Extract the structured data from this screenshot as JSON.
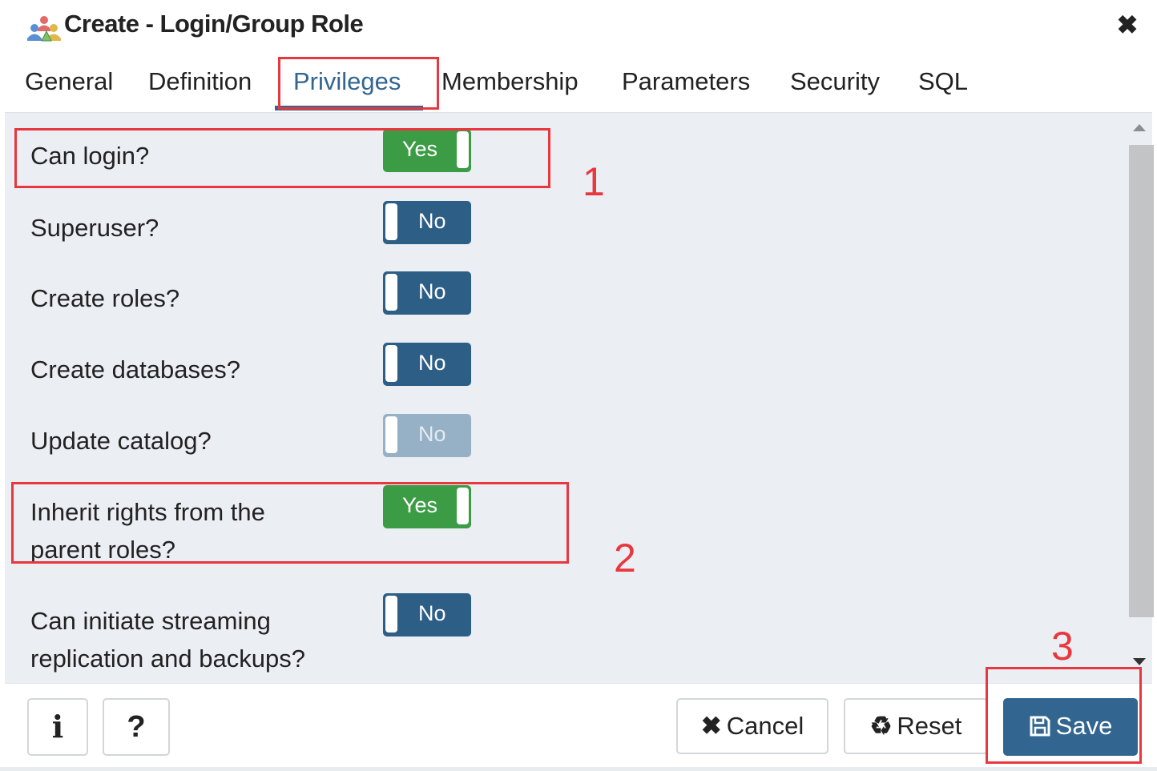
{
  "dialog": {
    "title": "Create - Login/Group Role",
    "close_glyph": "✖"
  },
  "tabs": [
    {
      "label": "General",
      "active": false
    },
    {
      "label": "Definition",
      "active": false
    },
    {
      "label": "Privileges",
      "active": true
    },
    {
      "label": "Membership",
      "active": false
    },
    {
      "label": "Parameters",
      "active": false
    },
    {
      "label": "Security",
      "active": false
    },
    {
      "label": "SQL",
      "active": false
    }
  ],
  "privileges": [
    {
      "label": "Can login?",
      "value": "Yes",
      "enabled": true
    },
    {
      "label": "Superuser?",
      "value": "No",
      "enabled": true
    },
    {
      "label": "Create roles?",
      "value": "No",
      "enabled": true
    },
    {
      "label": "Create databases?",
      "value": "No",
      "enabled": true
    },
    {
      "label": "Update catalog?",
      "value": "No",
      "enabled": false
    },
    {
      "label_line1": "Inherit rights from the",
      "label_line2": "parent roles?",
      "value": "Yes",
      "enabled": true
    },
    {
      "label_line1": "Can initiate streaming",
      "label_line2": "replication and backups?",
      "value": "No",
      "enabled": true
    }
  ],
  "footer": {
    "info_label": "i",
    "help_label": "?",
    "cancel_label": "Cancel",
    "reset_label": "Reset",
    "save_label": "Save"
  },
  "annotations": [
    "1",
    "2",
    "3"
  ],
  "colors": {
    "accent": "#326690",
    "toggle_yes": "#3c9c45",
    "toggle_no": "#2d5e86",
    "annotation": "#e8373f"
  }
}
